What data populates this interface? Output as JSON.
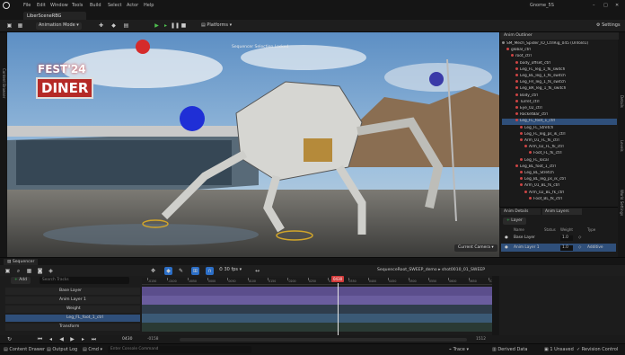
{
  "window": {
    "tab_title": "LiberSceneRBG",
    "project_name": "Gnome_5S",
    "menu": [
      "File",
      "Edit",
      "Window",
      "Tools",
      "Build",
      "Select",
      "Actor",
      "Help"
    ]
  },
  "toolbar": {
    "mode": "Animation Mode",
    "platforms": "Platforms",
    "settings": "Settings"
  },
  "viewport": {
    "overlay_text": "Sequencer Selection Locked",
    "camera_button": "Current Camera",
    "sign_top": "FEST'24",
    "sign_main": "DINER"
  },
  "side_tabs": {
    "left": [
      "Content Browser"
    ],
    "right": [
      "Details",
      "Levels",
      "World Settings"
    ]
  },
  "outliner": {
    "title": "Anim Outliner",
    "rows": [
      {
        "label": "SM_Mech_Spider_IO_CtrlRig_045 (Unfold1)",
        "indent": 0
      },
      {
        "label": "global_ctrl",
        "indent": 1
      },
      {
        "label": "root_ctrl",
        "indent": 2
      },
      {
        "label": "body_offset_ctrl",
        "indent": 3
      },
      {
        "label": "Leg_FL_leg_1_fk_switch",
        "indent": 3
      },
      {
        "label": "Leg_BL_leg_1_fk_switch",
        "indent": 3
      },
      {
        "label": "Leg_FR_leg_1_fk_switch",
        "indent": 3
      },
      {
        "label": "Leg_BR_leg_1_fk_switch",
        "indent": 3
      },
      {
        "label": "Body_ctrl",
        "indent": 3
      },
      {
        "label": "Turret_ctrl",
        "indent": 3
      },
      {
        "label": "Eye_02_ctrl",
        "indent": 3
      },
      {
        "label": "RocketBar_ctrl",
        "indent": 3
      },
      {
        "label": "Leg_FL_foot_1_ctrl",
        "indent": 3
      },
      {
        "label": "Leg_FL_Stretch",
        "indent": 4
      },
      {
        "label": "Leg_FL_leg_ps_ik_ctrl",
        "indent": 4
      },
      {
        "label": "Arm_01_FL_fk_ctrl",
        "indent": 4
      },
      {
        "label": "Arm_02_FL_fk_ctrl",
        "indent": 5
      },
      {
        "label": "Foot_FL_fk_ctrl",
        "indent": 6
      },
      {
        "label": "Leg_FL_local",
        "indent": 4
      },
      {
        "label": "Leg_BL_foot_1_ctrl",
        "indent": 3
      },
      {
        "label": "Leg_BL_Stretch",
        "indent": 4
      },
      {
        "label": "Leg_BL_leg_ps_ik_ctrl",
        "indent": 4
      },
      {
        "label": "Arm_01_BL_fk_ctrl",
        "indent": 4
      },
      {
        "label": "Arm_02_BL_fk_ctrl",
        "indent": 5
      },
      {
        "label": "Foot_BL_fk_ctrl",
        "indent": 6
      }
    ],
    "selected_index": 12
  },
  "details": {
    "tabs": [
      "Anim Details",
      "Anim Layers"
    ],
    "add_button": "Layer",
    "columns": [
      "Name",
      "Status",
      "Weight",
      "Type"
    ],
    "layers": [
      {
        "name": "Base Layer",
        "weight": "1.0",
        "type": ""
      },
      {
        "name": "Anim Layer 1",
        "weight": "1.0",
        "type": "Additive"
      }
    ]
  },
  "sequencer": {
    "title": "Sequencer",
    "fps": "30 fps",
    "add_button": "Add",
    "search_placeholder": "Search Tracks",
    "breadcrumb": [
      "SequenceRoot_SWEEP_demo",
      "shot0010_01_SWEEP"
    ],
    "playhead": "0430",
    "range_start": "-0158",
    "range_end": "1512",
    "frame_readout": "0430",
    "tracks": [
      {
        "label": "Base Layer",
        "indent": 0
      },
      {
        "label": "Anim Layer 1",
        "indent": 0
      },
      {
        "label": "Weight",
        "indent": 1
      },
      {
        "label": "Leg_FL_foot_1_ctrl",
        "indent": 1
      },
      {
        "label": "Transform",
        "indent": 0
      }
    ],
    "ruler": [
      "-0150",
      "-0100",
      "-0050",
      "0000",
      "0050",
      "0100",
      "0150",
      "0200",
      "0250",
      "0300",
      "0350",
      "0400",
      "0450",
      "0500",
      "0550",
      "0600",
      "0650",
      "0700"
    ]
  },
  "statusbar": {
    "content_drawer": "Content Drawer",
    "output_log": "Output Log",
    "cmd": "Cmd",
    "cmd_placeholder": "Enter Console Command",
    "trace": "Trace",
    "derived_data": "Derived Data",
    "unsaved": "1 Unsaved",
    "revision_control": "Revision Control"
  },
  "colors": {
    "accent": "#2c6fc7",
    "selection": "#2f4f7a",
    "playhead": "#d43b3b",
    "anim_layer": "#6a5d9e",
    "green": "#30b24b",
    "red_ctrl": "#c23a3a"
  }
}
